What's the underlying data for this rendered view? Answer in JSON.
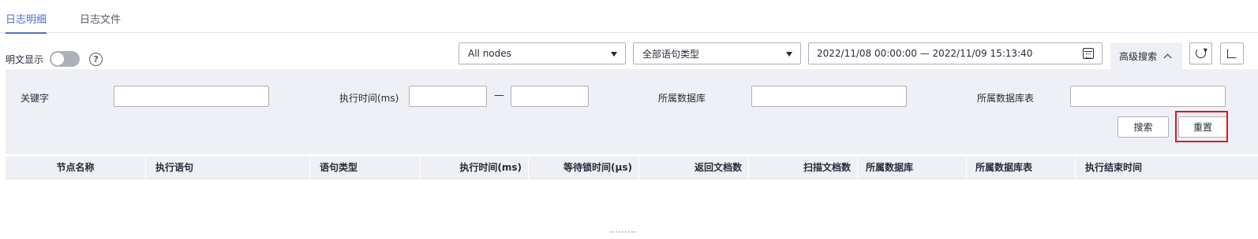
{
  "tabs": [
    {
      "label": "日志明细",
      "active": true
    },
    {
      "label": "日志文件",
      "active": false
    }
  ],
  "toolbar": {
    "plaintext_label": "明文显示",
    "plaintext_on": false,
    "help_glyph": "?",
    "node_select": "All nodes",
    "statement_type_select": "全部语句类型",
    "date_range": "2022/11/08 00:00:00 — 2022/11/09 15:13:40",
    "advanced_search_label": "高级搜索"
  },
  "advanced": {
    "keyword_label": "关键字",
    "keyword_value": "",
    "exec_time_label": "执行时间(ms)",
    "exec_time_min": "",
    "exec_time_max": "",
    "range_dash": "—",
    "database_label": "所属数据库",
    "database_value": "",
    "table_label": "所属数据库表",
    "table_value": "",
    "search_button": "搜索",
    "reset_button": "重置"
  },
  "table": {
    "columns": [
      "节点名称",
      "执行语句",
      "语句类型",
      "执行时间(ms)",
      "等待锁时间(μs)",
      "返回文档数",
      "扫描文档数",
      "所属数据库",
      "所属数据库表",
      "执行结束时间"
    ],
    "rows": []
  },
  "colors": {
    "accent": "#526ecc",
    "panel_bg": "#eef0f5",
    "highlight_border": "#e3141f"
  }
}
